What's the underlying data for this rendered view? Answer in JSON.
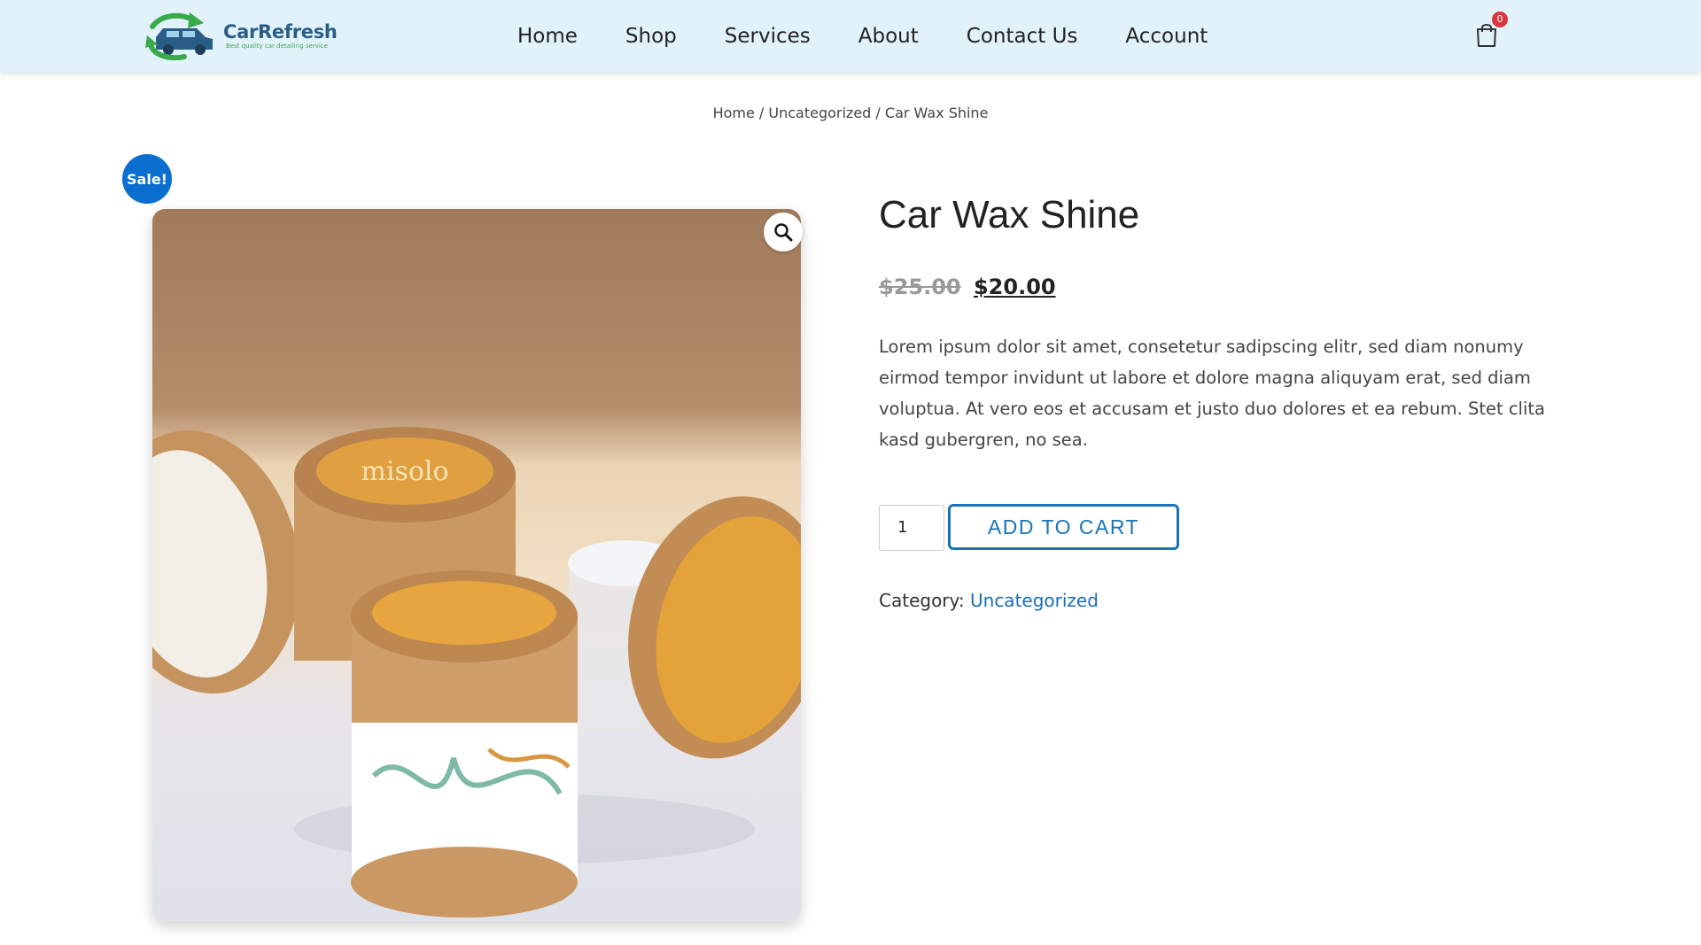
{
  "header": {
    "logo": {
      "name": "CarRefresh",
      "tagline": "Best quality car detailing service"
    },
    "nav": [
      "Home",
      "Shop",
      "Services",
      "About",
      "Contact Us",
      "Account"
    ],
    "cart_count": "0"
  },
  "breadcrumb": {
    "home": "Home",
    "category": "Uncategorized",
    "current": "Car Wax Shine",
    "separator": " / "
  },
  "product": {
    "sale_badge": "Sale!",
    "title": "Car Wax Shine",
    "price_old": "$25.00",
    "price_new": "$20.00",
    "description": "Lorem ipsum dolor sit amet, consetetur sadipscing elitr, sed diam nonumy eirmod tempor invidunt ut labore et dolore magna aliquyam erat, sed diam voluptua. At vero eos et accusam et justo duo dolores et ea rebum. Stet clita kasd gubergren, no sea.",
    "quantity": "1",
    "add_to_cart_label": "ADD TO CART",
    "category_label": "Category:",
    "category_value": "Uncategorized",
    "image_jar_label": "misolo"
  },
  "colors": {
    "header_bg": "#e1f2fb",
    "accent": "#1a73b8",
    "sale_badge": "#0a6fcf",
    "cart_badge": "#d9363e"
  },
  "icons": {
    "zoom": "magnifier-icon",
    "cart": "shopping-bag-icon"
  }
}
